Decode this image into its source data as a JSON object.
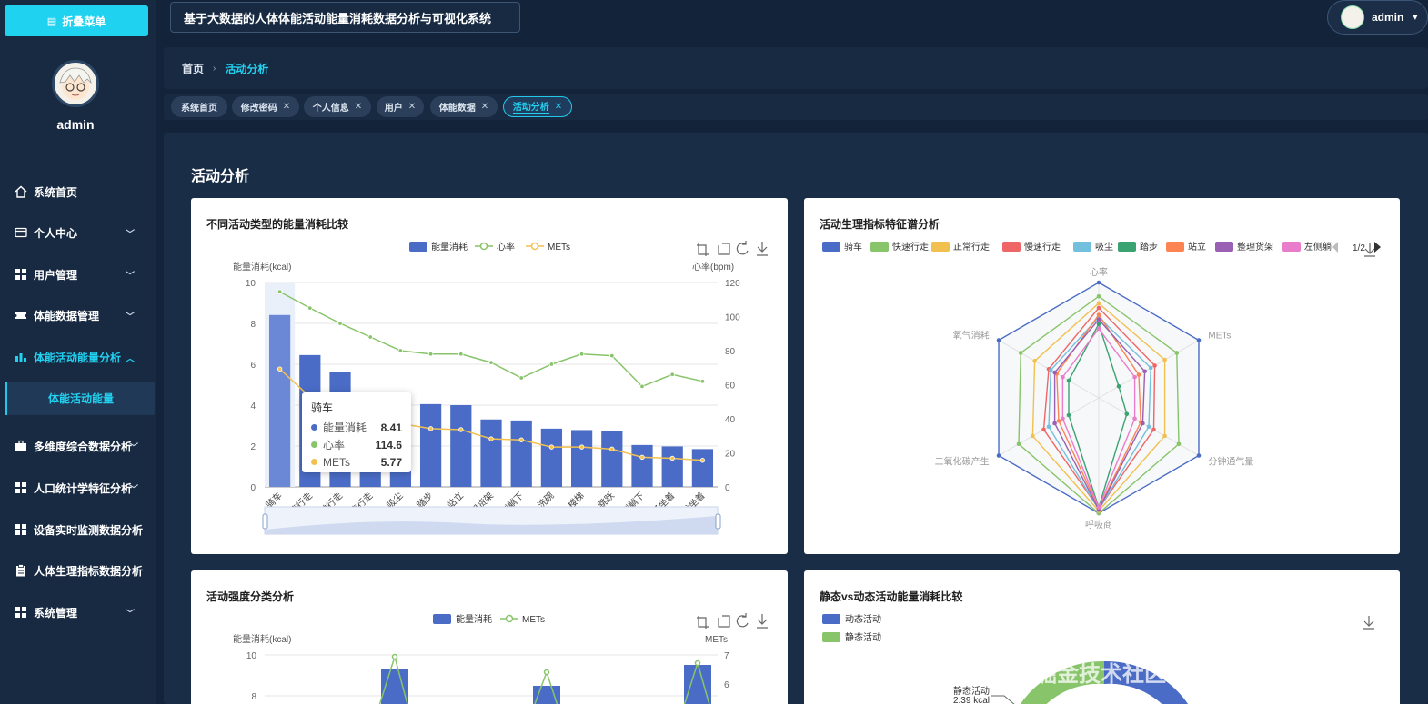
{
  "app": {
    "title": "基于大数据的人体体能活动能量消耗数据分析与可视化系统",
    "user": "admin"
  },
  "sidebar": {
    "collapse_label": "折叠菜单",
    "username": "admin",
    "items": [
      {
        "label": "系统首页",
        "icon": "home-icon",
        "expandable": false
      },
      {
        "label": "个人中心",
        "icon": "card-icon",
        "expandable": true
      },
      {
        "label": "用户管理",
        "icon": "grid-icon",
        "expandable": true
      },
      {
        "label": "体能数据管理",
        "icon": "ticket-icon",
        "expandable": true
      },
      {
        "label": "体能活动能量分析",
        "icon": "chart-icon",
        "expandable": true,
        "expanded": true
      },
      {
        "label": "多维度综合数据分析",
        "icon": "briefcase-icon",
        "expandable": true
      },
      {
        "label": "人口统计学特征分析",
        "icon": "grid-icon",
        "expandable": true
      },
      {
        "label": "设备实时监测数据分析",
        "icon": "grid-icon",
        "expandable": false
      },
      {
        "label": "人体生理指标数据分析",
        "icon": "clipboard-icon",
        "expandable": false
      },
      {
        "label": "系统管理",
        "icon": "grid-icon",
        "expandable": true
      }
    ],
    "submenu_active": "体能活动能量"
  },
  "breadcrumb": {
    "home": "首页",
    "current": "活动分析"
  },
  "tabs": [
    {
      "label": "系统首页",
      "closable": false,
      "active": false
    },
    {
      "label": "修改密码",
      "closable": true,
      "active": false
    },
    {
      "label": "个人信息",
      "closable": true,
      "active": false
    },
    {
      "label": "用户",
      "closable": true,
      "active": false
    },
    {
      "label": "体能数据",
      "closable": true,
      "active": false
    },
    {
      "label": "活动分析",
      "closable": true,
      "active": true
    }
  ],
  "page_title": "活动分析",
  "watermark": "掘金技术社区 @ 计算机毕业设计江挽",
  "colors": {
    "accent": "#22d0f0",
    "bar": "#4a6cc6",
    "heart": "#88c46a",
    "mets": "#f2c04e"
  },
  "chart_data": [
    {
      "type": "bar",
      "title": "不同活动类型的能量消耗比较",
      "legend": [
        "能量消耗",
        "心率",
        "METs"
      ],
      "ylabel": "能量消耗(kcal)",
      "ylabel_right": "心率(bpm)",
      "ylim": [
        0,
        10
      ],
      "ylim_right": [
        0,
        120
      ],
      "yticks": [
        "0",
        "2",
        "4",
        "6",
        "8",
        "10"
      ],
      "yticks_right": [
        "0",
        "20",
        "40",
        "60",
        "80",
        "100",
        "120"
      ],
      "categories": [
        "骑车",
        "快速行走",
        "正常行走",
        "慢速行走",
        "吸尘",
        "踏步",
        "站立",
        "整理货架",
        "左侧躺下",
        "洗碗",
        "上楼梯",
        "向上跳跃",
        "右侧躺下",
        "椅子坐着",
        "沙发坐着"
      ],
      "series": [
        {
          "name": "能量消耗",
          "kind": "bar",
          "axis": "left",
          "values": [
            8.41,
            6.45,
            5.6,
            4.2,
            3.9,
            4.05,
            4.0,
            3.3,
            3.25,
            2.85,
            2.78,
            2.72,
            2.05,
            1.98,
            1.85
          ]
        },
        {
          "name": "心率",
          "kind": "line",
          "axis": "right",
          "values": [
            114.6,
            105,
            96,
            88,
            80,
            78,
            78,
            73,
            64,
            72,
            78,
            77,
            59,
            66,
            62
          ]
        },
        {
          "name": "METs",
          "kind": "line",
          "axis": "left",
          "values": [
            5.77,
            4.4,
            3.7,
            3.3,
            3.1,
            2.85,
            2.8,
            2.35,
            2.3,
            1.95,
            1.95,
            1.85,
            1.45,
            1.4,
            1.3
          ]
        }
      ],
      "tooltip": {
        "title": "骑车",
        "rows": [
          {
            "name": "能量消耗",
            "value": "8.41"
          },
          {
            "name": "心率",
            "value": "114.6"
          },
          {
            "name": "METs",
            "value": "5.77"
          }
        ]
      }
    },
    {
      "type": "radar",
      "title": "活动生理指标特征谱分析",
      "legend": [
        "骑车",
        "快速行走",
        "正常行走",
        "慢速行走",
        "吸尘",
        "踏步",
        "站立",
        "整理货架",
        "左侧躺"
      ],
      "legend_page": "1/2",
      "indicators": [
        "心率",
        "METs",
        "分钟通气量",
        "呼吸商",
        "二氧化碳产生",
        "氧气消耗"
      ],
      "series": [
        {
          "name": "骑车",
          "values": [
            1.0,
            1.0,
            1.0,
            1.0,
            1.0,
            1.0
          ]
        },
        {
          "name": "快速行走",
          "values": [
            0.88,
            0.78,
            0.8,
            1.0,
            0.8,
            0.78
          ]
        },
        {
          "name": "正常行走",
          "values": [
            0.82,
            0.66,
            0.66,
            0.98,
            0.66,
            0.64
          ]
        },
        {
          "name": "慢速行走",
          "values": [
            0.78,
            0.56,
            0.55,
            0.96,
            0.55,
            0.5
          ]
        },
        {
          "name": "吸尘",
          "values": [
            0.7,
            0.52,
            0.5,
            0.97,
            0.5,
            0.48
          ]
        },
        {
          "name": "踏步",
          "values": [
            0.64,
            0.2,
            0.28,
            0.95,
            0.3,
            0.3
          ]
        },
        {
          "name": "站立",
          "values": [
            0.72,
            0.4,
            0.42,
            0.96,
            0.4,
            0.42
          ]
        },
        {
          "name": "整理货架",
          "values": [
            0.68,
            0.46,
            0.44,
            0.97,
            0.44,
            0.44
          ]
        },
        {
          "name": "左侧躺",
          "values": [
            0.6,
            0.36,
            0.36,
            0.95,
            0.36,
            0.36
          ]
        }
      ]
    },
    {
      "type": "bar",
      "title": "活动强度分类分析",
      "legend": [
        "能量消耗",
        "METs"
      ],
      "ylabel": "能量消耗(kcal)",
      "ylabel_right": "METs",
      "yticks_visible": [
        "10",
        "8"
      ],
      "yticks_right_visible": [
        "7",
        "6"
      ],
      "ylim": [
        0,
        10
      ],
      "ylim_right": [
        0,
        7
      ],
      "series": [
        {
          "name": "能量消耗",
          "kind": "bar",
          "axis": "left",
          "values_visible": [
            9.3,
            8.5,
            9.5
          ]
        },
        {
          "name": "METs",
          "kind": "line",
          "axis": "right",
          "values_visible": [
            6.9,
            6.4,
            6.7
          ]
        }
      ]
    },
    {
      "type": "pie",
      "title": "静态vs动态活动能量消耗比较",
      "legend": [
        "动态活动",
        "静态活动"
      ],
      "annotation": {
        "name": "静态活动",
        "value": "2.39 kcal"
      }
    }
  ]
}
